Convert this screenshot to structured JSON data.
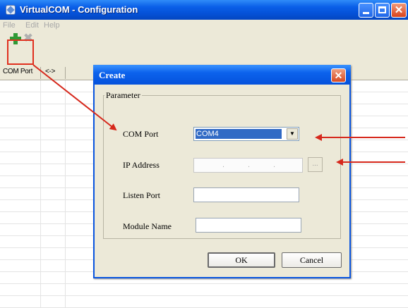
{
  "window": {
    "title": "VirtualCOM - Configuration",
    "app_icon": "app-icon",
    "controls": {
      "minimize_icon": "minimize-icon",
      "maximize_icon": "maximize-icon",
      "close_glyph": "✕"
    }
  },
  "menu": {
    "items": [
      "File",
      "Edit",
      "Help"
    ]
  },
  "toolbar": {
    "add_icon": "plus-icon",
    "delete_icon": "x-icon",
    "delete_glyph": "✖",
    "add_color": "#2f9a36"
  },
  "list": {
    "columns": [
      "COM Port",
      "<->"
    ]
  },
  "dialog": {
    "title": "Create",
    "close_glyph": "✕",
    "group_label": "Parameter",
    "fields": {
      "com_port": {
        "label": "COM Port",
        "value": "COM4"
      },
      "ip_address": {
        "label": "IP Address",
        "value": "",
        "dots": [
          ".",
          ".",
          "."
        ],
        "browse_label": "..."
      },
      "listen_port": {
        "label": "Listen Port",
        "value": ""
      },
      "module_name": {
        "label": "Module Name",
        "value": ""
      }
    },
    "buttons": {
      "ok": "OK",
      "cancel": "Cancel"
    },
    "combo_arrow": "▼"
  },
  "annotations": {
    "highlight_color": "#e0301e",
    "arrow_color": "#d6281c"
  }
}
